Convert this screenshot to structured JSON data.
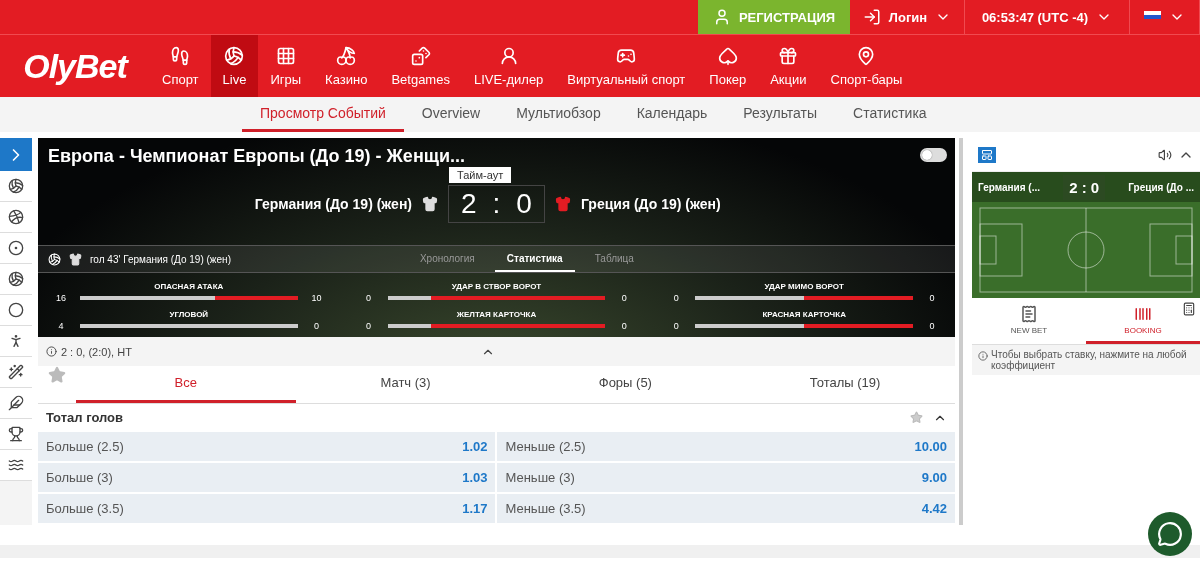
{
  "logo": "OlyBet",
  "top_bar": {
    "register": "РЕГИСТРАЦИЯ",
    "login": "Логин",
    "time": "06:53:47 (UTC -4)"
  },
  "nav": [
    {
      "label": "Спорт",
      "selected": false
    },
    {
      "label": "Live",
      "selected": true
    },
    {
      "label": "Игры",
      "selected": false
    },
    {
      "label": "Казино",
      "selected": false
    },
    {
      "label": "Betgames",
      "selected": false
    },
    {
      "label": "LIVE-дилер",
      "selected": false
    },
    {
      "label": "Виртуальный спорт",
      "selected": false
    },
    {
      "label": "Покер",
      "selected": false
    },
    {
      "label": "Акции",
      "selected": false
    },
    {
      "label": "Спорт-бары",
      "selected": false
    }
  ],
  "sub_nav": [
    {
      "label": "Просмотр Событий",
      "selected": true
    },
    {
      "label": "Overview",
      "selected": false
    },
    {
      "label": "Мультиобзор",
      "selected": false
    },
    {
      "label": "Календарь",
      "selected": false
    },
    {
      "label": "Результаты",
      "selected": false
    },
    {
      "label": "Статистика",
      "selected": false
    }
  ],
  "event": {
    "video_toggle_on": false,
    "title": "Европа - Чемпионат Европы (До 19) - Женщи...",
    "status": "Тайм-аут",
    "home": "Германия (До 19) (жен)",
    "away": "Греция (До 19) (жен)",
    "home_score": "2",
    "separator": ":",
    "away_score": "0",
    "last_event": "гол 43' Германия (До 19) (жен)",
    "tabs": [
      {
        "label": "Хронология",
        "selected": false
      },
      {
        "label": "Статистика",
        "selected": true
      },
      {
        "label": "Таблица",
        "selected": false
      }
    ],
    "stats": [
      {
        "name": "ОПАСНАЯ АТАКА",
        "home": "16",
        "away": "10",
        "level": 0.62
      },
      {
        "name": "УДАР В СТВОР ВОРОТ",
        "home": "0",
        "away": "0",
        "level": 0.2
      },
      {
        "name": "УДАР МИМО ВОРОТ",
        "home": "0",
        "away": "0",
        "level": 0.5
      },
      {
        "name": "УГЛОВОЙ",
        "home": "4",
        "away": "0",
        "level": 1
      },
      {
        "name": "ЖЕЛТАЯ КАРТОЧКА",
        "home": "0",
        "away": "0",
        "level": 0.2
      },
      {
        "name": "КРАСНАЯ КАРТОЧКА",
        "home": "0",
        "away": "0",
        "level": 0.5
      }
    ],
    "summary": "2 : 0, (2:0), НТ"
  },
  "market_tabs": [
    {
      "label": "Все",
      "selected": true
    },
    {
      "label": "Матч (3)",
      "selected": false
    },
    {
      "label": "Форы (5)",
      "selected": false
    },
    {
      "label": "Тоталы (19)",
      "selected": false
    }
  ],
  "market": {
    "title": "Тотал голов",
    "rows": [
      [
        {
          "label": "Больше (2.5)",
          "odds": "1.02"
        },
        {
          "label": "Меньше (2.5)",
          "odds": "10.00"
        }
      ],
      [
        {
          "label": "Больше (3)",
          "odds": "1.03"
        },
        {
          "label": "Меньше (3)",
          "odds": "9.00"
        }
      ],
      [
        {
          "label": "Больше (3.5)",
          "odds": "1.17"
        },
        {
          "label": "Меньше (3.5)",
          "odds": "4.42"
        }
      ]
    ]
  },
  "tracker": {
    "home": "Германия (...",
    "score": "2 : 0",
    "away": "Греция (До ..."
  },
  "betslip_tabs": [
    {
      "label": "NEW BET",
      "selected": false
    },
    {
      "label": "BOOKING",
      "selected": true
    }
  ],
  "betslip_hint": "Чтобы выбрать ставку, нажмите на любой коэффициент"
}
